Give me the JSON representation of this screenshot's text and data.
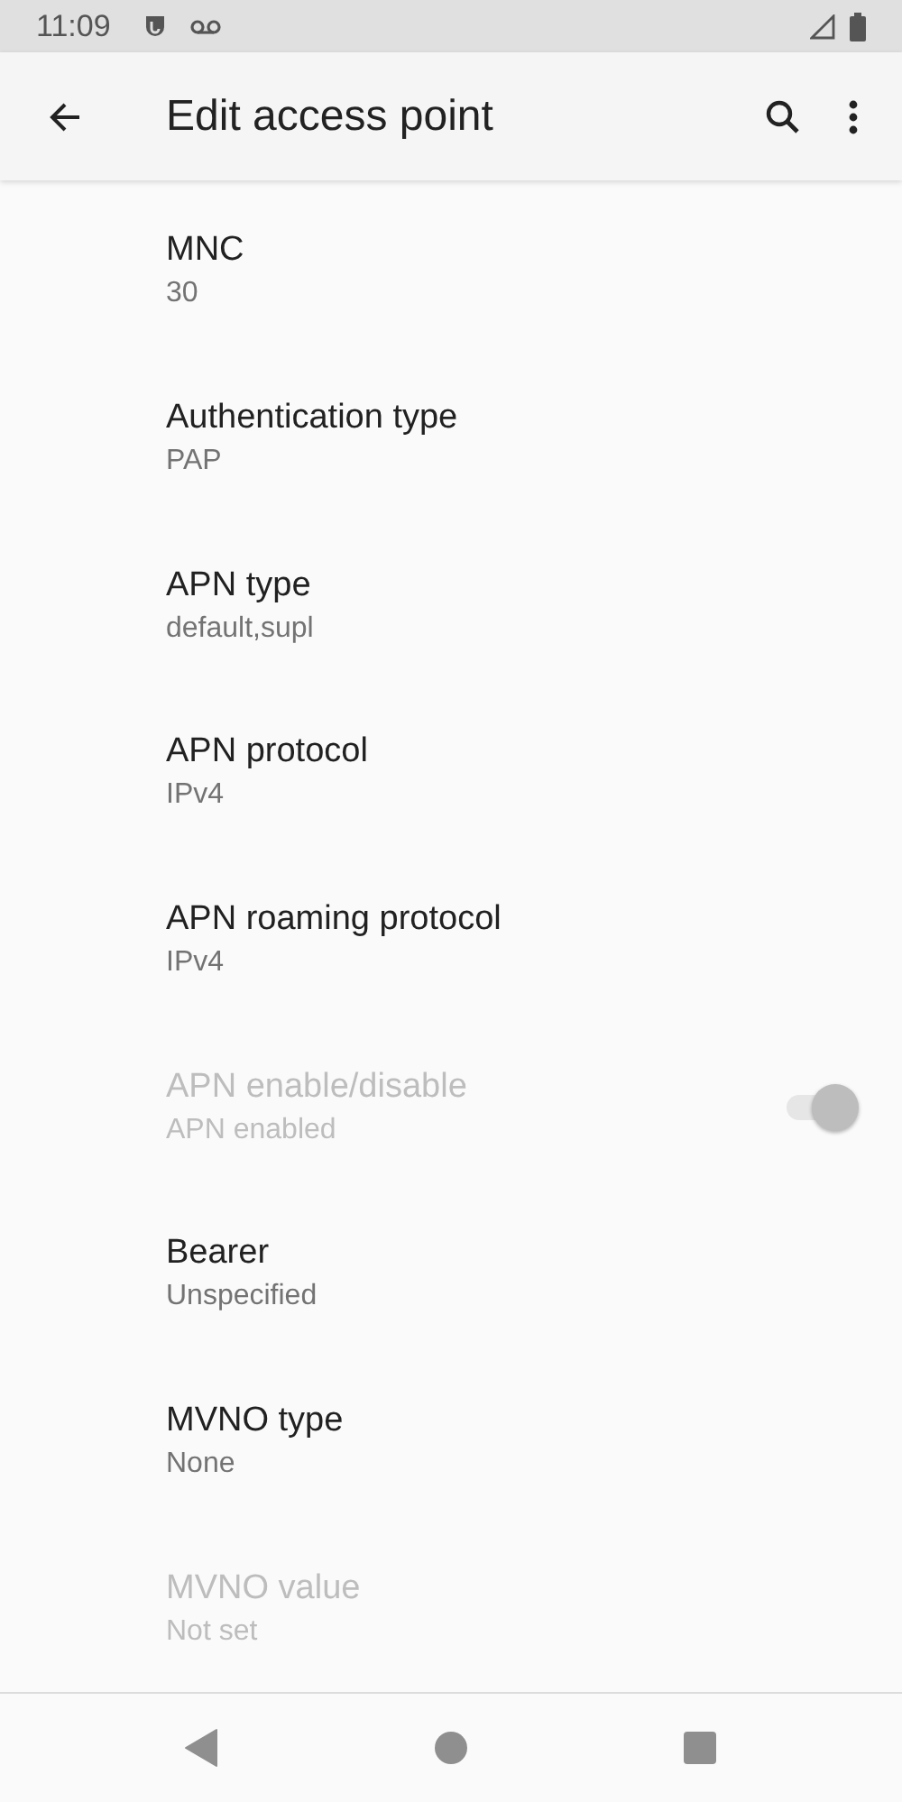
{
  "status_bar": {
    "time": "11:09"
  },
  "app_bar": {
    "title": "Edit access point"
  },
  "settings": [
    {
      "kind": "text",
      "title": "MNC",
      "summary": "30",
      "disabled": false
    },
    {
      "kind": "text",
      "title": "Authentication type",
      "summary": "PAP",
      "disabled": false
    },
    {
      "kind": "text",
      "title": "APN type",
      "summary": "default,supl",
      "disabled": false
    },
    {
      "kind": "text",
      "title": "APN protocol",
      "summary": "IPv4",
      "disabled": false
    },
    {
      "kind": "text",
      "title": "APN roaming protocol",
      "summary": "IPv4",
      "disabled": false
    },
    {
      "kind": "toggle",
      "title": "APN enable/disable",
      "summary": "APN enabled",
      "disabled": true,
      "on": true
    },
    {
      "kind": "text",
      "title": "Bearer",
      "summary": "Unspecified",
      "disabled": false
    },
    {
      "kind": "text",
      "title": "MVNO type",
      "summary": "None",
      "disabled": false
    },
    {
      "kind": "text",
      "title": "MVNO value",
      "summary": "Not set",
      "disabled": true
    }
  ]
}
